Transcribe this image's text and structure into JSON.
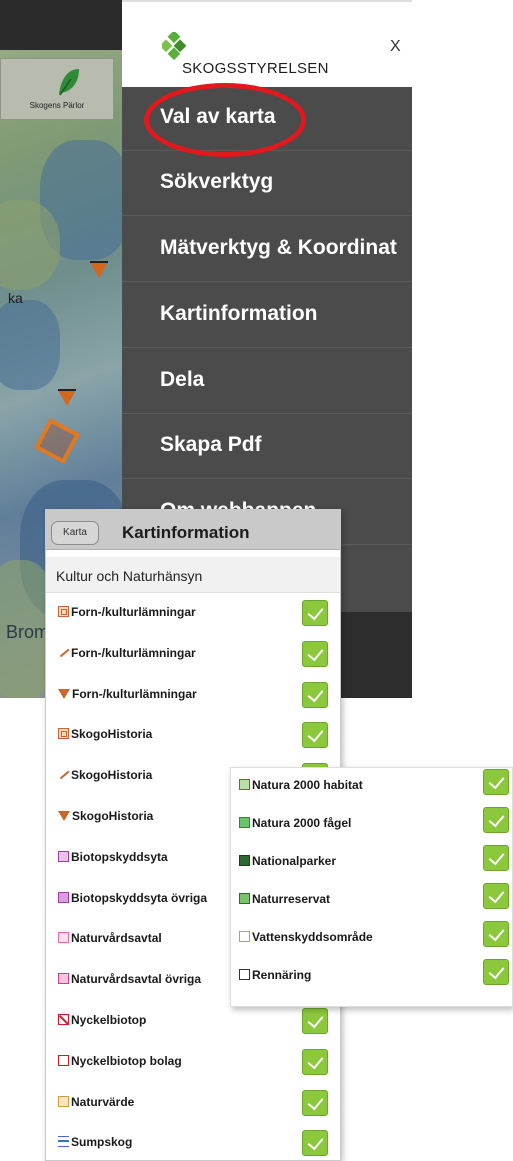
{
  "map": {
    "tool_label": "Skogens Pärlor",
    "place_labels": [
      "ka",
      "Brom"
    ]
  },
  "menu": {
    "logo_text": "SKOGSSTYRELSEN",
    "close_label": "X",
    "items": [
      {
        "label": "Val av karta"
      },
      {
        "label": "Sökverktyg"
      },
      {
        "label": "Mätverktyg & Koordinat"
      },
      {
        "label": "Kartinformation"
      },
      {
        "label": "Dela"
      },
      {
        "label": "Skapa Pdf"
      },
      {
        "label": "Om webbappen"
      }
    ],
    "highlight_color": "#e2191c"
  },
  "panel": {
    "back_label": "Karta",
    "title": "Kartinformation",
    "section": "Kultur och Naturhänsyn",
    "layers": [
      {
        "label": "Forn-/kulturlämningar",
        "symbol": "box-o",
        "checked": true
      },
      {
        "label": "Forn-/kulturlämningar",
        "symbol": "line-o",
        "checked": true
      },
      {
        "label": "Forn-/kulturlämningar",
        "symbol": "tri-o",
        "checked": true
      },
      {
        "label": "SkogoHistoria",
        "symbol": "box-o",
        "checked": true
      },
      {
        "label": "SkogoHistoria",
        "symbol": "line-o",
        "checked": true
      },
      {
        "label": "SkogoHistoria",
        "symbol": "tri-o",
        "checked": true
      },
      {
        "label": "Biotopskyddsyta",
        "symbol": "box-p",
        "checked": true
      },
      {
        "label": "Biotopskyddsyta övriga",
        "symbol": "box-p2",
        "checked": true
      },
      {
        "label": "Naturvårdsavtal",
        "symbol": "box-pk",
        "checked": true
      },
      {
        "label": "Naturvårdsavtal övriga",
        "symbol": "box-pk2",
        "checked": true
      },
      {
        "label": "Nyckelbiotop",
        "symbol": "box-r",
        "checked": true
      },
      {
        "label": "Nyckelbiotop bolag",
        "symbol": "box-r2",
        "checked": true
      },
      {
        "label": "Naturvärde",
        "symbol": "box-y",
        "checked": true
      },
      {
        "label": "Sumpskog",
        "symbol": "lines-b",
        "checked": true
      }
    ]
  },
  "float": {
    "layers": [
      {
        "label": "Natura 2000 habitat",
        "symbol": "box-g",
        "checked": true
      },
      {
        "label": "Natura 2000 fågel",
        "symbol": "box-g2",
        "checked": true
      },
      {
        "label": "Nationalparker",
        "symbol": "box-dg",
        "checked": true
      },
      {
        "label": "Naturreservat",
        "symbol": "box-mg",
        "checked": true
      },
      {
        "label": "Vattenskyddsområde",
        "symbol": "box-lv",
        "checked": true
      },
      {
        "label": "Rennäring",
        "symbol": "box-k",
        "checked": true
      }
    ]
  },
  "colors": {
    "menu_bg": "#4b4b4b",
    "checkbox_green": "#8cc83c",
    "brand_green": "#5aae3a"
  }
}
